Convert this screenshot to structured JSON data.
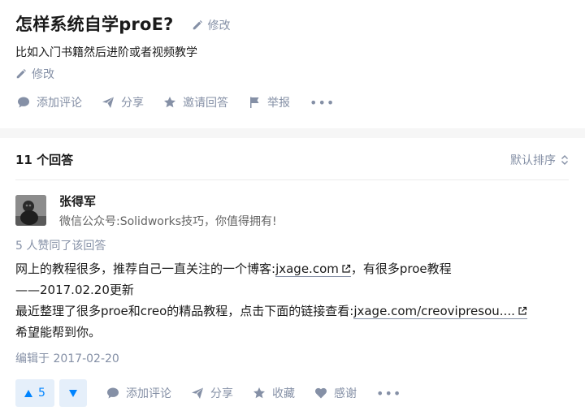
{
  "question": {
    "title": "怎样系统自学proE?",
    "edit_label": "修改",
    "description": "比如入门书籍然后进阶或者视频教学",
    "edit_label_2": "修改",
    "actions": {
      "comment": "添加评论",
      "share": "分享",
      "invite": "邀请回答",
      "report": "举报",
      "more": "•••"
    }
  },
  "answers": {
    "count_label": "11 个回答",
    "sort_label": "默认排序"
  },
  "answer": {
    "author_name": "张得军",
    "author_bio": "微信公众号:Solidworks技巧，你值得拥有!",
    "votes_text": "5 人赞同了该回答",
    "line1_pre": "网上的教程很多，推荐自己一直关注的一个博客:",
    "link1": "jxage.com",
    "line1_post": "，有很多proe教程",
    "line2": "——2017.02.20更新",
    "line3_pre": "最近整理了很多proe和creo的精品教程，点击下面的链接查看:",
    "link2": "jxage.com/creovipresou....",
    "line4": "希望能帮到你。",
    "edited": "编辑于 2017-02-20",
    "upvote_count": "5",
    "actions": {
      "comment": "添加评论",
      "share": "分享",
      "collect": "收藏",
      "thanks": "感谢",
      "more": "•••"
    }
  }
}
